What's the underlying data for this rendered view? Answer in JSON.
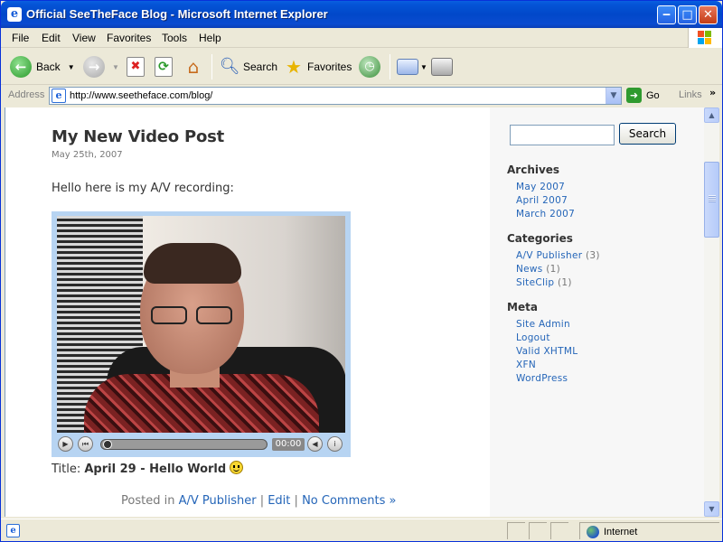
{
  "window": {
    "title": "Official SeeTheFace Blog - Microsoft Internet Explorer",
    "min_glyph": "‒",
    "max_glyph": "□",
    "close_glyph": "✕"
  },
  "menu": [
    "File",
    "Edit",
    "View",
    "Favorites",
    "Tools",
    "Help"
  ],
  "toolbar": {
    "back_label": "Back",
    "search_label": "Search",
    "favorites_label": "Favorites"
  },
  "address": {
    "label": "Address",
    "url": "http://www.seetheface.com/blog/",
    "go_label": "Go",
    "links_label": "Links"
  },
  "post": {
    "title": "My New Video Post",
    "date": "May 25th, 2007",
    "intro": "Hello here is my A/V recording:",
    "player_time": "00:00",
    "caption_prefix": "Title: ",
    "caption_title": "April 29 - Hello World",
    "meta_prefix": "Posted in ",
    "meta_category": "A/V Publisher",
    "meta_sep1": " | ",
    "meta_edit": "Edit",
    "meta_sep2": " | ",
    "meta_comments": "No Comments »"
  },
  "sidebar": {
    "search_button": "Search",
    "search_value": "",
    "archives_heading": "Archives",
    "archives": [
      "May 2007",
      "April 2007",
      "March 2007"
    ],
    "categories_heading": "Categories",
    "categories": [
      {
        "name": "A/V Publisher",
        "count": " (3)"
      },
      {
        "name": "News",
        "count": " (1)"
      },
      {
        "name": "SiteClip",
        "count": " (1)"
      }
    ],
    "meta_heading": "Meta",
    "meta": [
      "Site Admin",
      "Logout",
      "Valid XHTML",
      "XFN",
      "WordPress"
    ]
  },
  "status": {
    "zone": "Internet"
  },
  "colors": {
    "link": "#2465b8",
    "titlebar": "#0148c9",
    "player_frame": "#b7d4f2"
  }
}
